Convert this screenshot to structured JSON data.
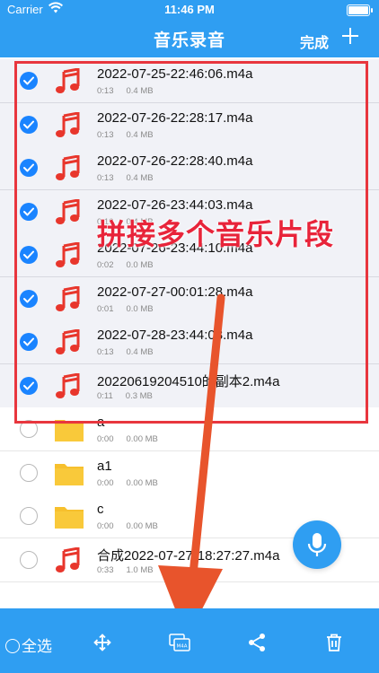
{
  "status": {
    "carrier": "Carrier",
    "time": "11:46 PM",
    "battery_level": 1.0
  },
  "header": {
    "title": "音乐录音",
    "done_label": "完成"
  },
  "files": [
    {
      "name": "2022-07-25-22:46:06.m4a",
      "duration": "0:13",
      "size": "0.4 MB",
      "type": "audio",
      "selected": true
    },
    {
      "name": "2022-07-26-22:28:17.m4a",
      "duration": "0:13",
      "size": "0.4 MB",
      "type": "audio",
      "selected": true
    },
    {
      "name": "2022-07-26-22:28:40.m4a",
      "duration": "0:13",
      "size": "0.4 MB",
      "type": "audio",
      "selected": true
    },
    {
      "name": "2022-07-26-23:44:03.m4a",
      "duration": "0:13",
      "size": "0.4 MB",
      "type": "audio",
      "selected": true
    },
    {
      "name": "2022-07-26-23:44:10.m4a",
      "duration": "0:02",
      "size": "0.0 MB",
      "type": "audio",
      "selected": true
    },
    {
      "name": "2022-07-27-00:01:28.m4a",
      "duration": "0:01",
      "size": "0.0 MB",
      "type": "audio",
      "selected": true
    },
    {
      "name": "2022-07-28-23:44:03.m4a",
      "duration": "0:13",
      "size": "0.4 MB",
      "type": "audio",
      "selected": true
    },
    {
      "name": "20220619204510的副本2.m4a",
      "duration": "0:11",
      "size": "0.3 MB",
      "type": "audio",
      "selected": true
    },
    {
      "name": "a",
      "duration": "0:00",
      "size": "0.00 MB",
      "type": "folder",
      "selected": false
    },
    {
      "name": "a1",
      "duration": "0:00",
      "size": "0.00 MB",
      "type": "folder",
      "selected": false
    },
    {
      "name": "c",
      "duration": "0:00",
      "size": "0.00 MB",
      "type": "folder",
      "selected": false
    },
    {
      "name": "合成2022-07-27-18:27:27.m4a",
      "duration": "0:33",
      "size": "1.0 MB",
      "type": "audio",
      "selected": false
    }
  ],
  "overlay": {
    "caption": "拼接多个音乐片段"
  },
  "toolbar": {
    "select_all_label": "全选",
    "icons": [
      "move-icon",
      "merge-m4a-icon",
      "share-icon",
      "trash-icon"
    ]
  },
  "colors": {
    "primary": "#2f9ef2",
    "check": "#1a84ff",
    "note": "#e8362c",
    "folder": "#f7c02d",
    "highlight": "#e8363e",
    "arrow": "#e8542c"
  }
}
